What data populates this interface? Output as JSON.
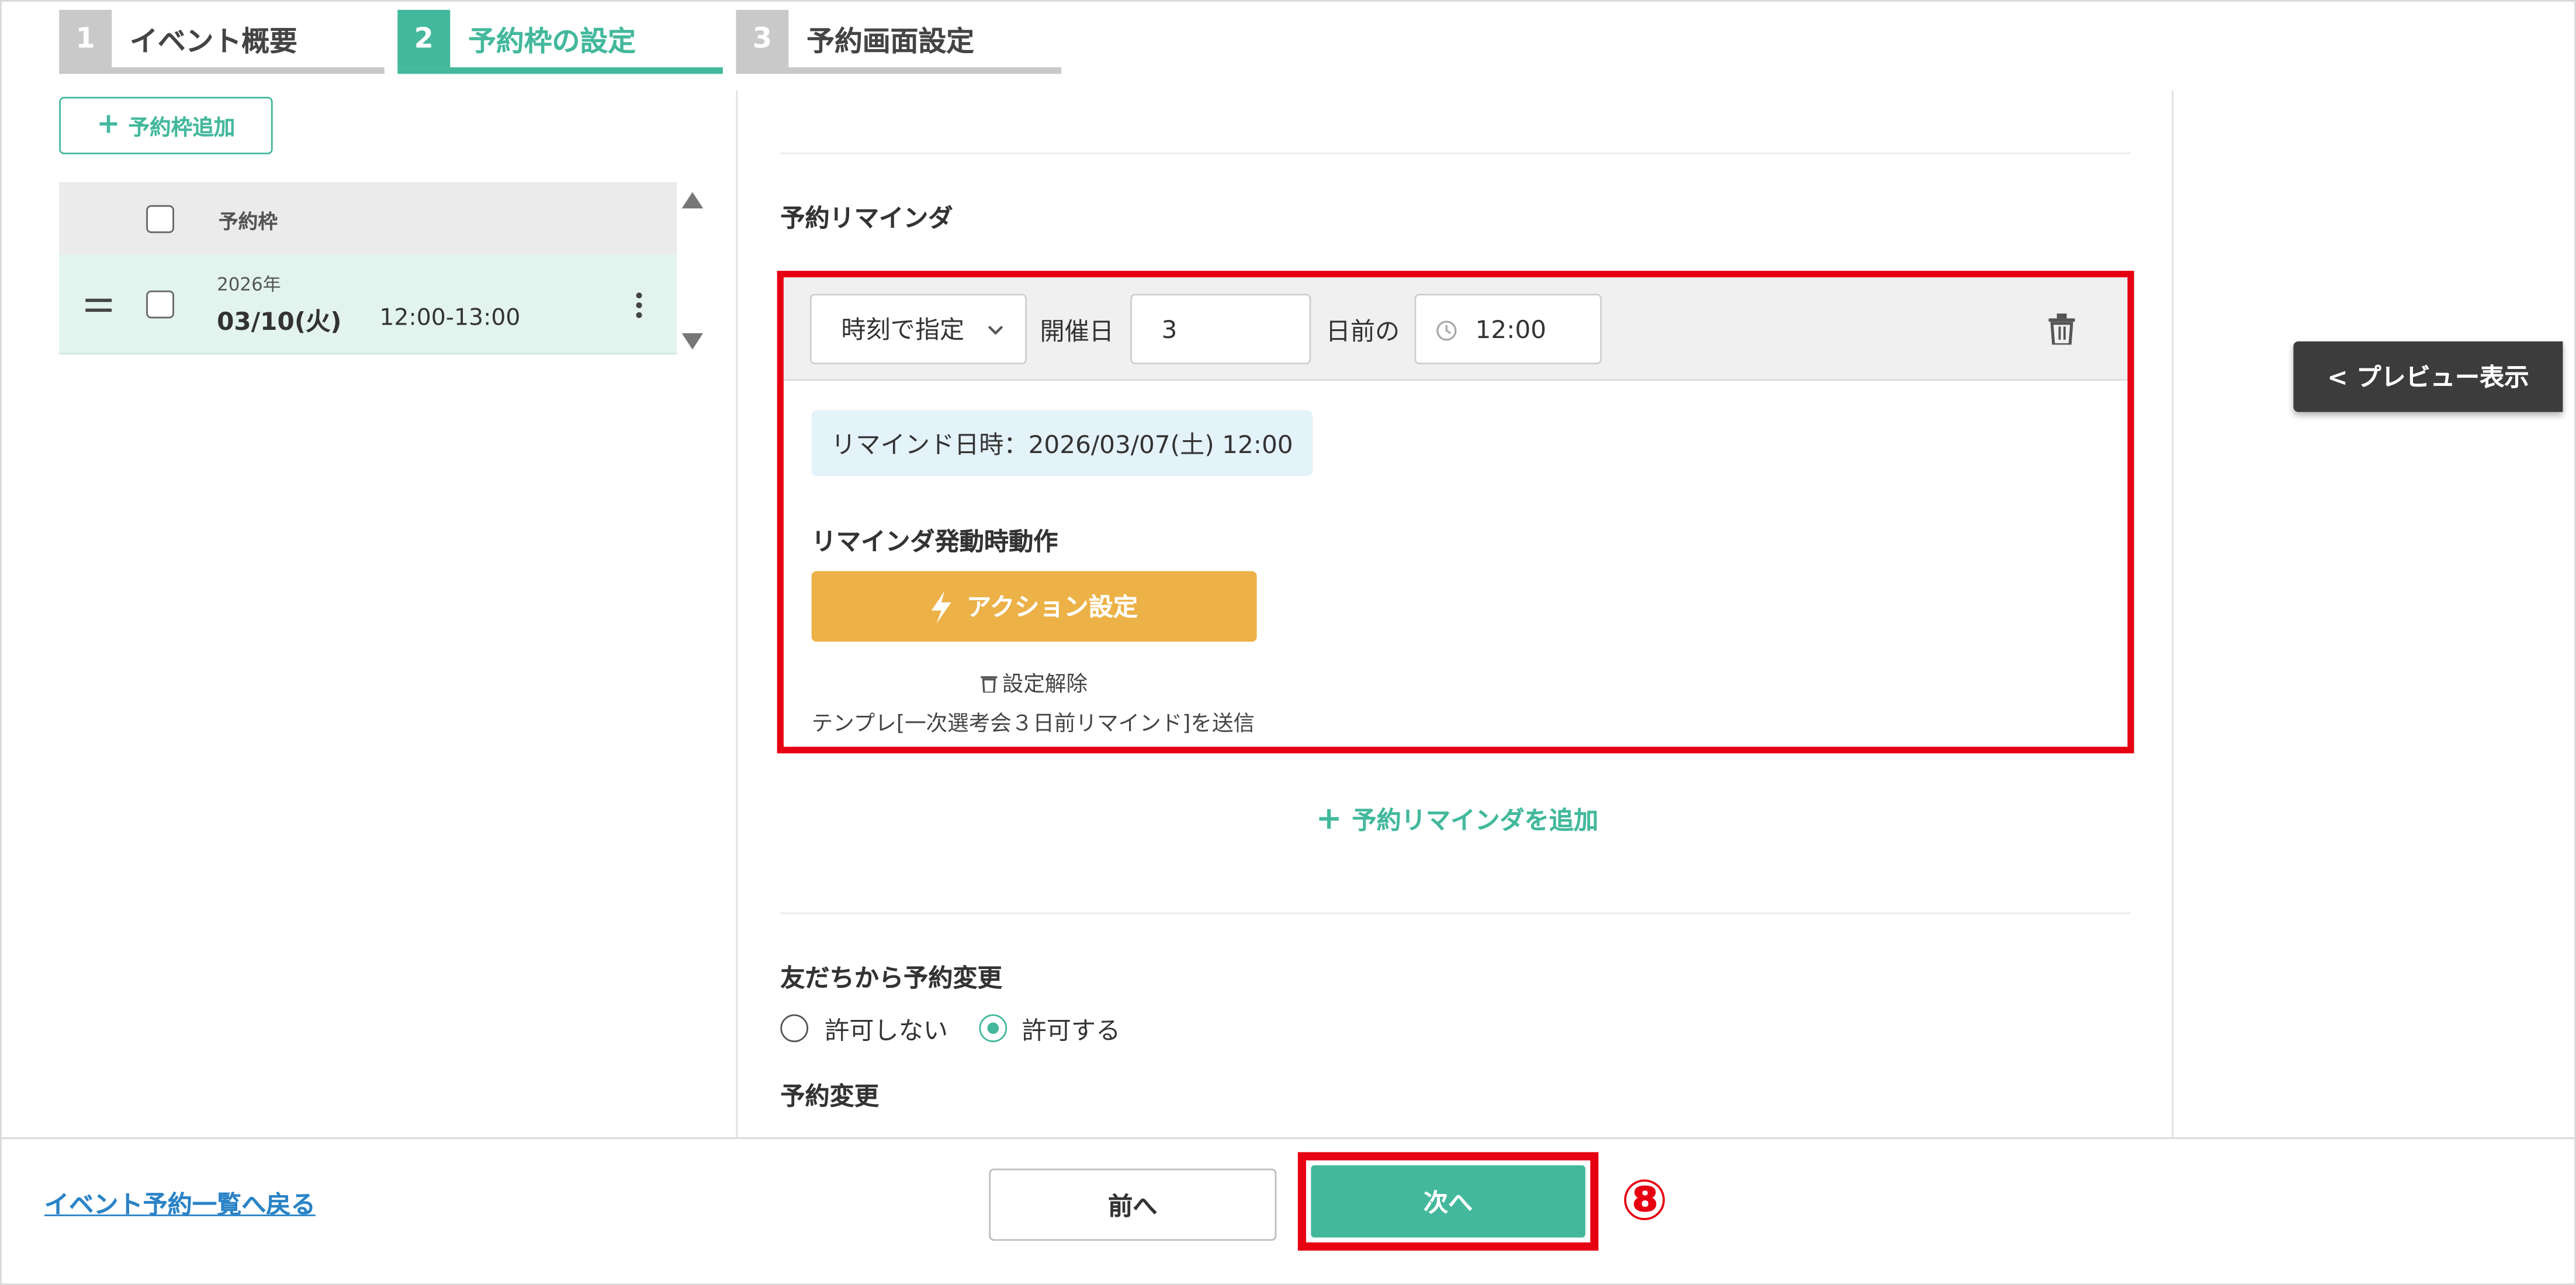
{
  "steps": [
    {
      "num": "1",
      "label": "イベント概要"
    },
    {
      "num": "2",
      "label": "予約枠の設定"
    },
    {
      "num": "3",
      "label": "予約画面設定"
    }
  ],
  "left": {
    "add_slot_label": "予約枠追加",
    "table_header": "予約枠",
    "slot": {
      "year": "2026年",
      "date": "03/10(火)",
      "time": "12:00-13:00"
    }
  },
  "reminder": {
    "section_title": "予約リマインダ",
    "mode_select": "時刻で指定",
    "day_label": "開催日",
    "days_value": "3",
    "before_label": "日前の",
    "time_value": "12:00",
    "remind_datetime": "リマインド日時：2026/03/07(土) 12:00",
    "action_title": "リマインダ発動時動作",
    "action_button": "アクション設定",
    "unset_label": "設定解除",
    "template_note": "テンプレ[一次選考会３日前リマインド]を送信",
    "add_reminder": "予約リマインダを追加"
  },
  "change": {
    "title": "友だちから予約変更",
    "options": [
      "許可しない",
      "許可する"
    ],
    "selected": 1,
    "next_title": "予約変更"
  },
  "preview_button": "< プレビュー表示",
  "footer": {
    "back_link": "イベント予約一覧へ戻る",
    "prev": "前へ",
    "next": "次へ",
    "marker": "⑧"
  },
  "colors": {
    "accent": "#43b89c",
    "highlight": "#e60012",
    "action": "#ecb147",
    "link": "#2a83c6"
  }
}
